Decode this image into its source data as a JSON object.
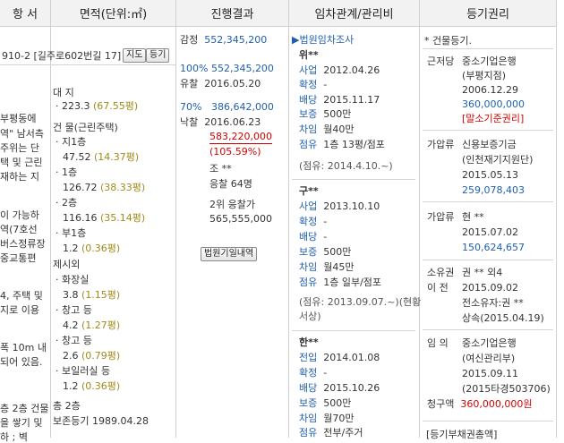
{
  "headers": {
    "c1": "항 서",
    "c2": "면적(단위:㎡)",
    "c3": "진행결과",
    "c4": "임차관계/관리비",
    "c5": "등기권리"
  },
  "col1": {
    "address": "910-2 [길주로602번길 17]",
    "btn_map": "지도",
    "btn_reg": "등기",
    "lines": [
      "부평동에",
      "역\" 남서측",
      "주위는 단",
      "택 및 근린",
      "재하는 지",
      "이 가능하",
      "역(7호선",
      "버스정류장",
      "중교통편",
      "4, 주택 및",
      "지로 이용",
      "폭 10m 내",
      "되어 있음.",
      "층 2층 건물",
      "을 쌓기 및",
      "하 ; 벽"
    ]
  },
  "area": {
    "land_title": "대 지",
    "land_value": "223.3",
    "land_pyeong": "(67.55평)",
    "bldg_title": "건 물(근린주택)",
    "floors": [
      {
        "name": "· 지1층",
        "value": "47.52",
        "pyeong": "(14.37평)"
      },
      {
        "name": "· 1층",
        "value": "126.72",
        "pyeong": "(38.33평)"
      },
      {
        "name": "· 2층",
        "value": "116.16",
        "pyeong": "(35.14평)"
      },
      {
        "name": "· 부1층",
        "value": "1.2",
        "pyeong": "(0.36평)"
      }
    ],
    "excl_title": "제시외",
    "excl": [
      {
        "name": "· 화장실",
        "value": "3.8",
        "pyeong": "(1.15평)"
      },
      {
        "name": "· 창고 등",
        "value": "4.2",
        "pyeong": "(1.27평)"
      },
      {
        "name": "· 창고 등",
        "value": "2.6",
        "pyeong": "(0.79평)"
      },
      {
        "name": "· 보일러실 등",
        "value": "1.2",
        "pyeong": "(0.36평)"
      }
    ],
    "total_floors": "총 2층",
    "preserve": "보존등기 1989.04.28"
  },
  "progress": {
    "appraisal_label": "감정",
    "appraisal_value": "552,345,200",
    "row2_pct": "100%",
    "row2_value": "552,345,200",
    "row3_label": "유찰",
    "row3_date": "2016.05.20",
    "row4_pct": "70%",
    "row4_value": "386,642,000",
    "sold_label": "낙찰",
    "sold_date": "2016.06.23",
    "sold_price": "583,220,000",
    "sold_rate": "(105.59%)",
    "buyer": "조 **",
    "bidders": "응찰 64명",
    "second_label": "2위 응찰가",
    "second_value": "565,555,000",
    "court_btn": "법원기일내역"
  },
  "lease": {
    "court_link": "▶법원임차조사",
    "tenants": [
      {
        "name": "위**",
        "rows": [
          {
            "label": "사업",
            "value": "2012.04.26"
          },
          {
            "label": "확정",
            "value": "-"
          },
          {
            "label": "배당",
            "value": "2015.11.17"
          },
          {
            "label": "보증",
            "value": "500만"
          },
          {
            "label": "차임",
            "value": "월40만"
          },
          {
            "label": "점유",
            "value": "1층 13평/점포"
          }
        ],
        "note": "(점유: 2014.4.10.~)"
      },
      {
        "name": "구**",
        "rows": [
          {
            "label": "사업",
            "value": "2013.10.10"
          },
          {
            "label": "확정",
            "value": "-"
          },
          {
            "label": "배당",
            "value": "-"
          },
          {
            "label": "보증",
            "value": "500만"
          },
          {
            "label": "차임",
            "value": "월45만"
          },
          {
            "label": "점유",
            "value": "1층 일부/점포"
          }
        ],
        "note": "(점유: 2013.09.07.~)(현황",
        "note2": "서상)"
      },
      {
        "name": "한**",
        "rows": [
          {
            "label": "전입",
            "value": "2014.01.08"
          },
          {
            "label": "확정",
            "value": "-"
          },
          {
            "label": "배당",
            "value": "2015.10.26"
          },
          {
            "label": "보증",
            "value": "500만"
          },
          {
            "label": "차임",
            "value": "월70만"
          },
          {
            "label": "점유",
            "value": "전부/주거"
          }
        ]
      }
    ]
  },
  "registry": {
    "head": "* 건물등기.",
    "r1": {
      "label": "근저당",
      "l1": "중소기업은행",
      "l2": "(부평지점)",
      "l3": "2006.12.29",
      "amount": "360,000,000",
      "note": "[말소기준권리]"
    },
    "r2": {
      "label": "가압류",
      "l1": "신용보증기금",
      "l2": "(인천재기지원단)",
      "l3": "2015.05.13",
      "amount": "259,078,403"
    },
    "r3": {
      "label": "가압류",
      "l1": "현 **",
      "l2": "2015.07.02",
      "amount": "150,624,657"
    },
    "r4": {
      "label1": "소유권",
      "v1": "권 ** 외4",
      "label2": "이   전",
      "v2": "2015.09.02",
      "v3": "전소유자:권 **",
      "v4": "상속(2015.04.19)"
    },
    "r5": {
      "label": "임    의",
      "l1": "중소기업은행",
      "l2": "(여신관리부)",
      "l3": "2015.09.11",
      "l4": "(2015타경503706)",
      "claim_label": "청구액",
      "claim": "360,000,000원"
    },
    "bottom": "[등기부채권총액]"
  }
}
